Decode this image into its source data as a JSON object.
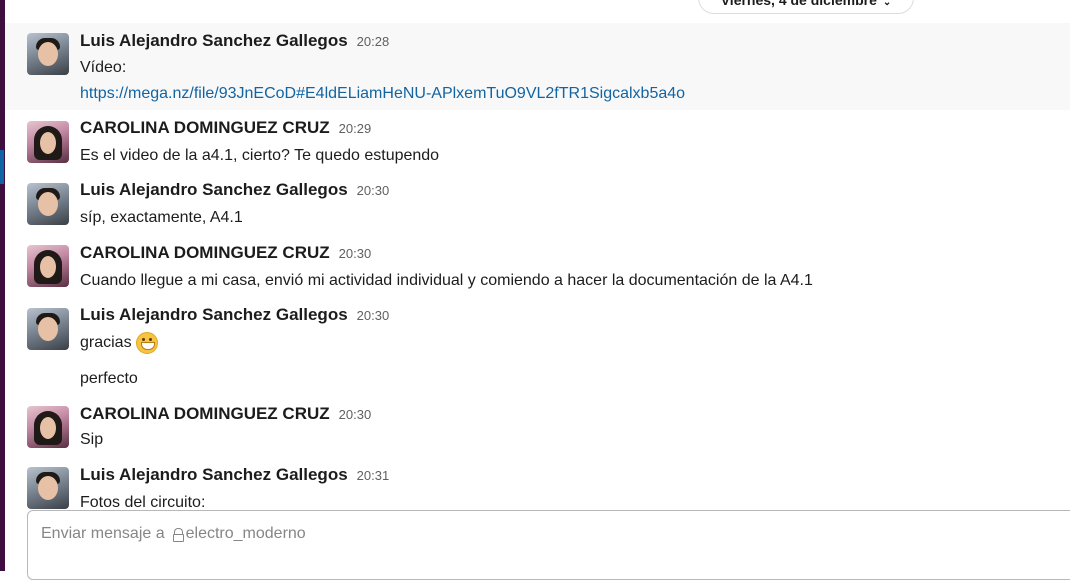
{
  "date_divider": {
    "label": "Viernes, 4 de diciembre"
  },
  "messages": [
    {
      "author": "Luis Alejandro Sanchez Gallegos",
      "time": "20:28",
      "lines": [
        "Vídeo:"
      ],
      "link": "https://mega.nz/file/93JnECoD#E4ldELiamHeNU-APlxemTuO9VL2fTR1Sigcalxb5a4o"
    },
    {
      "author": "CAROLINA DOMINGUEZ CRUZ",
      "time": "20:29",
      "lines": [
        "Es el video de la a4.1, cierto? Te quedo estupendo"
      ]
    },
    {
      "author": "Luis Alejandro Sanchez Gallegos",
      "time": "20:30",
      "lines": [
        "síp, exactamente, A4.1"
      ]
    },
    {
      "author": "CAROLINA DOMINGUEZ CRUZ",
      "time": "20:30",
      "lines": [
        "Cuando llegue a mi casa, envió mi actividad individual y comiendo a hacer la documentación de la A4.1"
      ]
    },
    {
      "author": "Luis Alejandro Sanchez Gallegos",
      "time": "20:30",
      "lines": [
        "gracias",
        "perfecto"
      ],
      "emoji": "grinning-face-emoji"
    },
    {
      "author": "CAROLINA DOMINGUEZ CRUZ",
      "time": "20:30",
      "lines": [
        "Sip"
      ]
    },
    {
      "author": "Luis Alejandro Sanchez Gallegos",
      "time": "20:31",
      "lines": [
        "Fotos del circuito:"
      ]
    }
  ],
  "composer": {
    "placeholder": "Enviar mensaje a",
    "channel": "electro_moderno",
    "channel_icon": "lock-icon"
  }
}
